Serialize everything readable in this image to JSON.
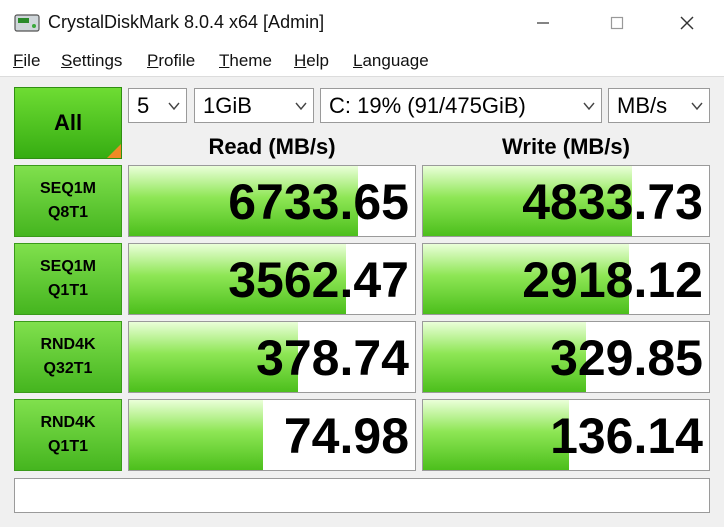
{
  "window": {
    "title": "CrystalDiskMark 8.0.4 x64 [Admin]",
    "controls": [
      "minimize-icon",
      "maximize-icon",
      "close-icon"
    ]
  },
  "menu": [
    {
      "underline": "F",
      "rest": "ile"
    },
    {
      "underline": "S",
      "rest": "ettings"
    },
    {
      "underline": "P",
      "rest": "rofile"
    },
    {
      "underline": "T",
      "rest": "heme"
    },
    {
      "underline": "H",
      "rest": "elp"
    },
    {
      "underline": "L",
      "rest": "anguage"
    }
  ],
  "toolbar": {
    "all_label": "All",
    "count": "5",
    "size": "1GiB",
    "drive": "C: 19% (91/475GiB)",
    "unit": "MB/s"
  },
  "headers": {
    "read": "Read (MB/s)",
    "write": "Write (MB/s)"
  },
  "tests": [
    {
      "line1": "SEQ1M",
      "line2": "Q8T1",
      "read": "6733.65",
      "write": "4833.73",
      "read_fill": 0.8,
      "write_fill": 0.73
    },
    {
      "line1": "SEQ1M",
      "line2": "Q1T1",
      "read": "3562.47",
      "write": "2918.12",
      "read_fill": 0.76,
      "write_fill": 0.72
    },
    {
      "line1": "RND4K",
      "line2": "Q32T1",
      "read": "378.74",
      "write": "329.85",
      "read_fill": 0.59,
      "write_fill": 0.57
    },
    {
      "line1": "RND4K",
      "line2": "Q1T1",
      "read": "74.98",
      "write": "136.14",
      "read_fill": 0.47,
      "write_fill": 0.51
    }
  ],
  "status": "",
  "colors": {
    "accent_green": "#4cbf1c",
    "corner_orange": "#f08a24"
  }
}
